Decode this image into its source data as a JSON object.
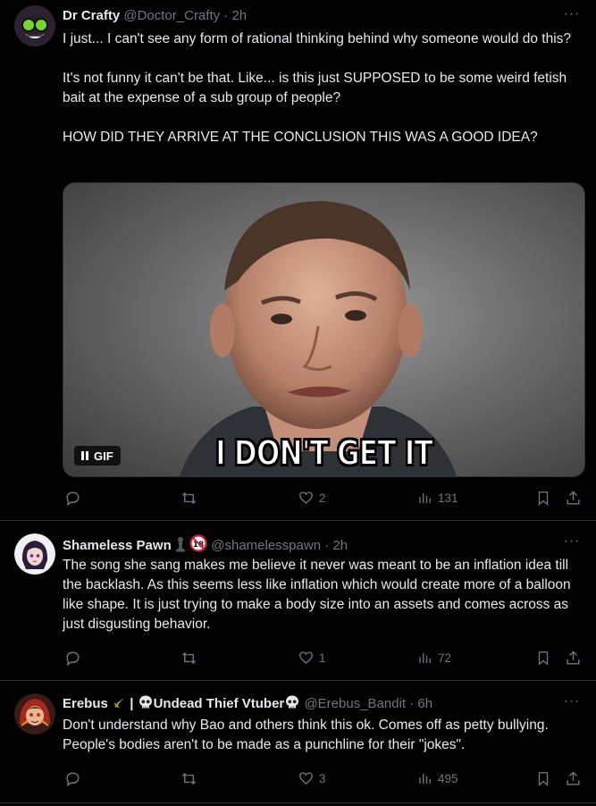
{
  "colors": {
    "background": "#000000",
    "text_primary": "#e7e9ea",
    "text_secondary": "#71767b",
    "divider": "#2f3336"
  },
  "tweets": [
    {
      "display_name": "Dr Crafty",
      "handle": "@Doctor_Crafty",
      "time": "2h",
      "avatar_icon": "green-goggles-character-avatar",
      "text": "I just... I can't see any form of rational thinking behind why someone would do this?\n\nIt's not funny it can't be that. Like... is this just SUPPOSED to be some weird fetish bait at the expense of a sub group of people?\n\nHOW DID THEY ARRIVE AT THE CONCLUSION THIS WAS A GOOD IDEA?",
      "media": {
        "type": "gif",
        "badge_label": "GIF",
        "caption": "I DON'T GET IT"
      },
      "stats": {
        "replies": "",
        "reposts": "",
        "likes": "2",
        "views": "131"
      }
    },
    {
      "display_name": "Shameless Pawn",
      "badges": [
        "chess-pawn-icon",
        "18-plus-icon"
      ],
      "handle": "@shamelesspawn",
      "time": "2h",
      "avatar_icon": "dark-haired-anime-avatar",
      "text": "The song she sang makes me believe it never was meant to be an inflation idea till the backlash. As this seems less like inflation which would create more of a balloon like shape. It is just trying to make a body size into an assets and comes across as just disgusting behavior.",
      "stats": {
        "replies": "",
        "reposts": "",
        "likes": "1",
        "views": "72"
      }
    },
    {
      "display_name": "Erebus",
      "display_name_part2": "|",
      "display_name_part3": "Undead Thief Vtuber",
      "badges": [
        "dagger-icon",
        "skull-icon",
        "skull-icon"
      ],
      "handle": "@Erebus_Bandit",
      "time": "6h",
      "avatar_icon": "red-hooded-character-avatar",
      "text": "Don't understand why Bao and others think this ok. Comes off as petty bullying. People's bodies aren't to be made as a punchline for their \"jokes\".",
      "stats": {
        "replies": "",
        "reposts": "",
        "likes": "3",
        "views": "495"
      }
    }
  ]
}
